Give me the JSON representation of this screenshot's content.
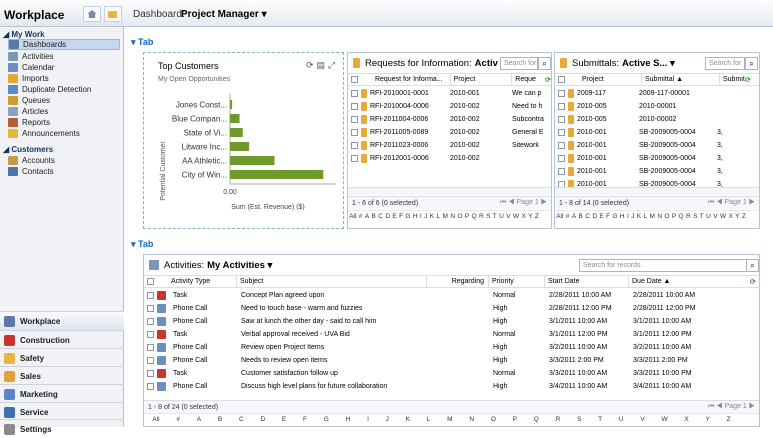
{
  "sidebar": {
    "title": "Workplace",
    "my_work": "My Work",
    "items": [
      {
        "label": "Dashboards"
      },
      {
        "label": "Activities"
      },
      {
        "label": "Calendar"
      },
      {
        "label": "Imports"
      },
      {
        "label": "Duplicate Detection"
      },
      {
        "label": "Queues"
      },
      {
        "label": "Articles"
      },
      {
        "label": "Reports"
      },
      {
        "label": "Announcements"
      }
    ],
    "customers": "Customers",
    "customer_items": [
      {
        "label": "Accounts"
      },
      {
        "label": "Contacts"
      }
    ],
    "areas": [
      {
        "label": "Workplace"
      },
      {
        "label": "Construction"
      },
      {
        "label": "Safety"
      },
      {
        "label": "Sales"
      },
      {
        "label": "Marketing"
      },
      {
        "label": "Service"
      },
      {
        "label": "Settings"
      }
    ]
  },
  "header": {
    "prefix": "Dashboard:",
    "name": "Project Manager"
  },
  "tab1": "Tab",
  "tab2": "Tab",
  "chart": {
    "title": "Top Customers",
    "subtitle": "My Open Opportunities",
    "ylabel": "Potential Customer",
    "xlabel": "Sum (Est. Revenue) ($)",
    "tick": "0.00"
  },
  "chart_data": {
    "type": "bar",
    "orientation": "horizontal",
    "title": "Top Customers",
    "subtitle": "My Open Opportunities",
    "categories": [
      "Jones Const...",
      "Blue Compan...",
      "State of Vi...",
      "Litware Inc...",
      "AA Athletic...",
      "City of Win..."
    ],
    "values": [
      2,
      9,
      12,
      18,
      42,
      88
    ],
    "xlabel": "Sum (Est. Revenue) ($)",
    "ylabel": "Potential Customer",
    "xticks": [
      "0.00"
    ],
    "color": "#6f9a2c"
  },
  "rfi": {
    "title_prefix": "Requests for Information:",
    "title_view": "Activ",
    "search": "Search for",
    "cols": [
      "Request for Informa...",
      "Project",
      "Reque"
    ],
    "rows": [
      [
        "RFI-2010001-0001",
        "2010-001",
        "We can p"
      ],
      [
        "RFI-2010004-0006",
        "2010-002",
        "Need to h"
      ],
      [
        "RFI-2011004-0006",
        "2010-002",
        "Subcontra"
      ],
      [
        "RFI-2011005-0089",
        "2010-002",
        "General E"
      ],
      [
        "RFI-2011023-0006",
        "2010-002",
        "Sitework"
      ],
      [
        "RFI-2012001-0006",
        "2010-002",
        ""
      ]
    ],
    "footer": "1 - 6 of 6 (0 selected)",
    "page": "Page 1"
  },
  "sub": {
    "title_prefix": "Submittals:",
    "title_view": "Active S...",
    "search": "Search for",
    "cols": [
      "Project",
      "Submittal",
      "Submit"
    ],
    "rows": [
      [
        "2009-117",
        "2009-117-00001",
        ""
      ],
      [
        "2010-005",
        "2010-00001",
        ""
      ],
      [
        "2010-005",
        "2010-00002",
        ""
      ],
      [
        "2010-001",
        "SB-2009005-0004",
        "3,"
      ],
      [
        "2010-001",
        "SB-2009005-0004",
        "3,"
      ],
      [
        "2010-001",
        "SB-2009005-0004",
        "3,"
      ],
      [
        "2010-001",
        "SB-2009005-0004",
        "3,"
      ],
      [
        "2010-001",
        "SB-2009005-0004",
        "3,"
      ]
    ],
    "footer": "1 - 8 of 14 (0 selected)",
    "page": "Page 1"
  },
  "alpha": [
    "All",
    "#",
    "A",
    "B",
    "C",
    "D",
    "E",
    "F",
    "G",
    "H",
    "I",
    "J",
    "K",
    "L",
    "M",
    "N",
    "O",
    "P",
    "Q",
    "R",
    "S",
    "T",
    "U",
    "V",
    "W",
    "X",
    "Y",
    "Z"
  ],
  "act": {
    "title_prefix": "Activities:",
    "title_view": "My Activities",
    "search": "Search for records",
    "cols": [
      "Activity Type",
      "Subject",
      "Regarding",
      "Priority",
      "Start Date",
      "Due Date"
    ],
    "rows": [
      [
        "Task",
        "Concept Plan agreed upon",
        "",
        "Normal",
        "2/28/2011 10:00 AM",
        "2/28/2011 10:00 AM"
      ],
      [
        "Phone Call",
        "Need to touch base - warm and fuzzies",
        "",
        "High",
        "2/28/2011 12:00 PM",
        "2/28/2011 12:00 PM"
      ],
      [
        "Phone Call",
        "Saw at lunch the other day - said to call him",
        "",
        "High",
        "3/1/2011 10:00 AM",
        "3/1/2011 10:00 AM"
      ],
      [
        "Task",
        "Verbal approval received - UVA Bid",
        "",
        "Normal",
        "3/1/2011 12:00 PM",
        "3/1/2011 12:00 PM"
      ],
      [
        "Phone Call",
        "Review open Project Items",
        "",
        "High",
        "3/2/2011 10:00 AM",
        "3/2/2011 10:00 AM"
      ],
      [
        "Phone Call",
        "Needs to review open items",
        "",
        "High",
        "3/3/2011 2:00 PM",
        "3/3/2011 2:00 PM"
      ],
      [
        "Task",
        "Customer satisfaction follow up",
        "",
        "Normal",
        "3/3/2011 10:00 AM",
        "3/3/2011 10:00 PM"
      ],
      [
        "Phone Call",
        "Discuss high level plans for future collaboration",
        "",
        "High",
        "3/4/2011 10:00 AM",
        "3/4/2011 10:00 AM"
      ]
    ],
    "footer": "1 - 8 of 24 (0 selected)",
    "page": "Page 1"
  }
}
